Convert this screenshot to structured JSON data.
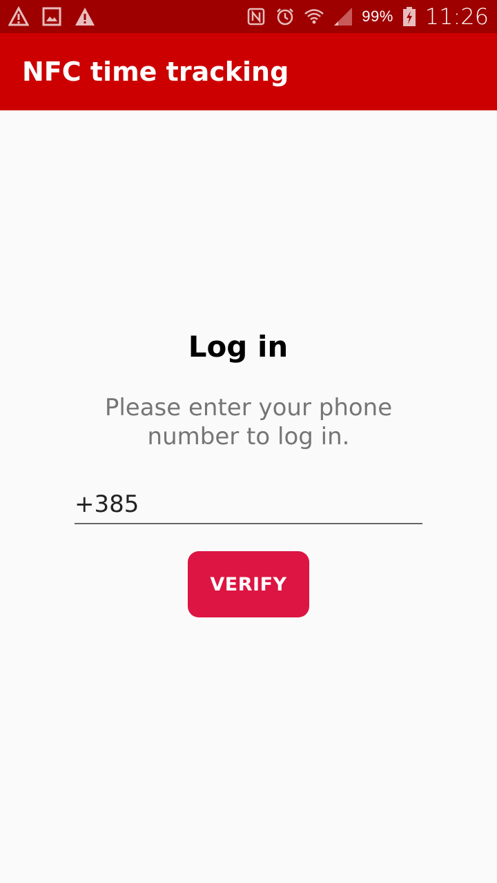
{
  "status_bar": {
    "left_icons": [
      "warning-icon",
      "image-icon",
      "alert-icon"
    ],
    "right_icons": [
      "nfc-icon",
      "alarm-icon",
      "wifi-icon",
      "signal-icon",
      "battery-charging-icon"
    ],
    "battery_level": "99%",
    "time": "11:26"
  },
  "app_bar": {
    "title": "NFC time tracking"
  },
  "login": {
    "heading": "Log in",
    "subtitle": "Please enter your phone number to log in.",
    "phone_value": "+385",
    "verify_label": "VERIFY"
  },
  "colors": {
    "status_bar": "#9e0000",
    "app_bar": "#cc0000",
    "button": "#dc1542",
    "background": "#fafafa"
  }
}
